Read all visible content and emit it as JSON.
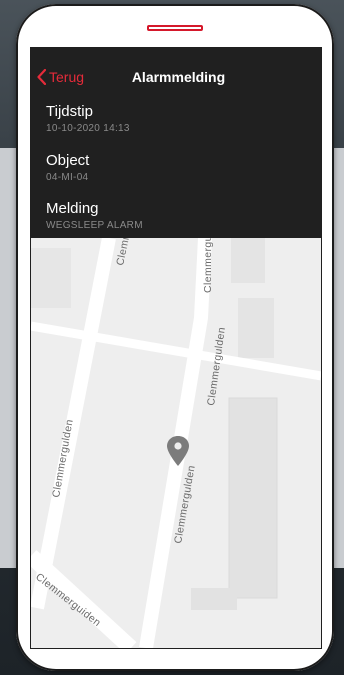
{
  "nav": {
    "back_label": "Terug",
    "title": "Alarmmelding"
  },
  "details": [
    {
      "label": "Tijdstip",
      "value": "10-10-2020 14:13"
    },
    {
      "label": "Object",
      "value": "04-MI-04"
    },
    {
      "label": "Melding",
      "value": "WEGSLEEP ALARM"
    }
  ],
  "map": {
    "street_name": "Clemmerguiden",
    "street_labels": [
      "Clemmergulden",
      "Clemmergulden",
      "Clemmergulden",
      "Clemmergulden",
      "Clemmergulden",
      "Clemmerguiden"
    ],
    "marker_icon": "location-pin-icon"
  },
  "colors": {
    "accent": "#e52b3a",
    "panel_bg": "#202020",
    "value_text": "#8a8a8a"
  }
}
